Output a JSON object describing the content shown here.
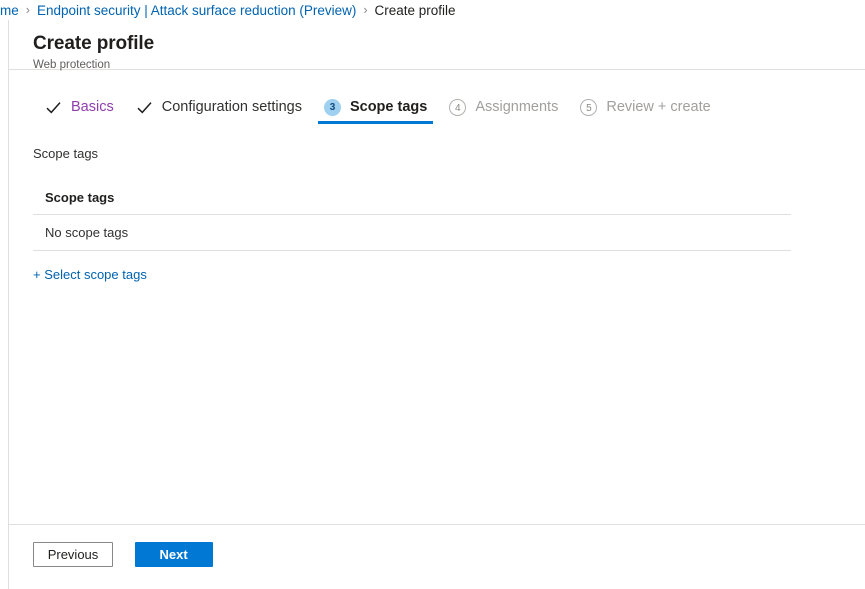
{
  "breadcrumb": {
    "items": [
      {
        "label": "me",
        "type": "link",
        "name": "breadcrumb-home"
      },
      {
        "label": "Endpoint security | Attack surface reduction (Preview)",
        "type": "link",
        "name": "breadcrumb-endpoint-security"
      },
      {
        "label": "Create profile",
        "type": "current",
        "name": "breadcrumb-create-profile"
      }
    ],
    "separator": "›"
  },
  "blade": {
    "title": "Create profile",
    "subtitle": "Web protection"
  },
  "wizard": {
    "steps": [
      {
        "number": "1",
        "label": "Basics",
        "state": "visited",
        "icon": "check-icon"
      },
      {
        "number": "2",
        "label": "Configuration settings",
        "state": "done",
        "icon": "check-icon"
      },
      {
        "number": "3",
        "label": "Scope tags",
        "state": "active",
        "icon": ""
      },
      {
        "number": "4",
        "label": "Assignments",
        "state": "pending",
        "icon": ""
      },
      {
        "number": "5",
        "label": "Review + create",
        "state": "pending",
        "icon": ""
      }
    ]
  },
  "main": {
    "section_label": "Scope tags",
    "table": {
      "header": "Scope tags",
      "rows": [
        "No scope tags"
      ]
    },
    "select_link": "+ Select scope tags"
  },
  "footer": {
    "previous_label": "Previous",
    "next_label": "Next"
  },
  "colors": {
    "accent_blue": "#0078d4",
    "link_blue": "#0063b1",
    "visited_purple": "#8e3ead",
    "badge_fill": "#9fd0ef",
    "badge_text": "#0f4b7d",
    "divider": "#e1dfdd",
    "text_primary": "#201f1e",
    "text_secondary": "#605e5c",
    "text_disabled": "#a19f9d"
  }
}
